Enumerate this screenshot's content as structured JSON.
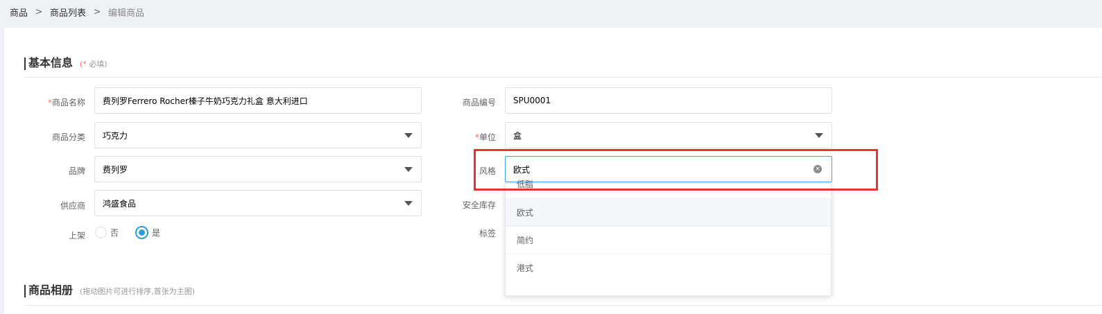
{
  "breadcrumb": {
    "items": [
      "商品",
      "商品列表",
      "编辑商品"
    ],
    "separator": ">"
  },
  "basic_info": {
    "title": "基本信息",
    "hint_star": "(*",
    "hint_text": "必填)"
  },
  "form": {
    "name": {
      "label": "商品名称",
      "required": "*",
      "value": "费列罗Ferrero Rocher榛子牛奶巧克力礼盒 意大利进口"
    },
    "code": {
      "label": "商品编号",
      "value": "SPU0001"
    },
    "category": {
      "label": "商品分类",
      "value": "巧克力"
    },
    "unit": {
      "label": "单位",
      "required": "*",
      "value": "盒"
    },
    "brand": {
      "label": "品牌",
      "value": "费列罗"
    },
    "style": {
      "label": "风格",
      "value": "欧式",
      "clear_icon": "×"
    },
    "supplier": {
      "label": "供应商",
      "value": "鸿盛食品"
    },
    "safety_stock": {
      "label": "安全库存"
    },
    "on_shelf": {
      "label": "上架",
      "options": [
        "否",
        "是"
      ],
      "selected": "是"
    },
    "tags": {
      "label": "标签"
    }
  },
  "style_dropdown": {
    "options": [
      "低脂",
      "欧式",
      "简约",
      "港式"
    ],
    "selected": "欧式"
  },
  "album": {
    "title": "商品相册",
    "hint": "(拖动图片可进行排序,首张为主图)"
  },
  "colors": {
    "accent": "#2a9de0",
    "required": "#f56c6c",
    "highlight": "#e53333"
  }
}
